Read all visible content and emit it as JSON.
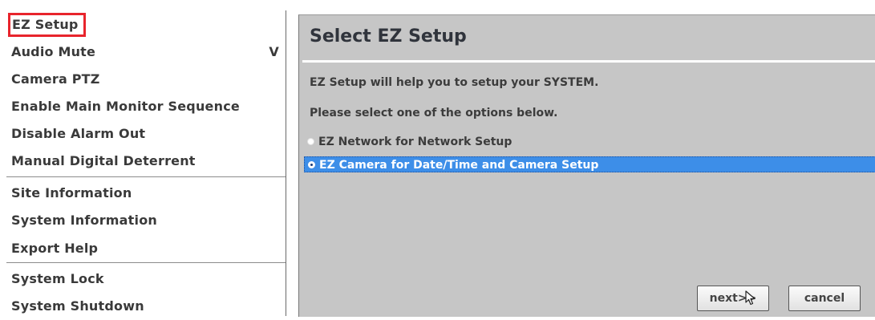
{
  "menu": {
    "items": [
      {
        "label": "EZ Setup"
      },
      {
        "label": "Audio Mute",
        "shortcut": "V"
      },
      {
        "label": "Camera PTZ"
      },
      {
        "label": "Enable Main Monitor Sequence"
      },
      {
        "label": "Disable Alarm Out"
      },
      {
        "label": "Manual Digital Deterrent"
      },
      {
        "label": "Site Information"
      },
      {
        "label": "System Information"
      },
      {
        "label": "Export Help"
      },
      {
        "label": "System Lock"
      },
      {
        "label": "System Shutdown"
      }
    ],
    "highlight_color": "#e8242c"
  },
  "dialog": {
    "title": "Select EZ Setup",
    "intro": "EZ Setup will help you to setup your SYSTEM.",
    "prompt": "Please select one of the options below.",
    "options": [
      {
        "label": "EZ Network for Network Setup",
        "selected": false
      },
      {
        "label": "EZ Camera for Date/Time and Camera Setup",
        "selected": true
      }
    ],
    "buttons": {
      "next": "next>>",
      "cancel": "cancel"
    },
    "background_color": "#c6c6c6",
    "selection_color": "#3d8ee8"
  }
}
